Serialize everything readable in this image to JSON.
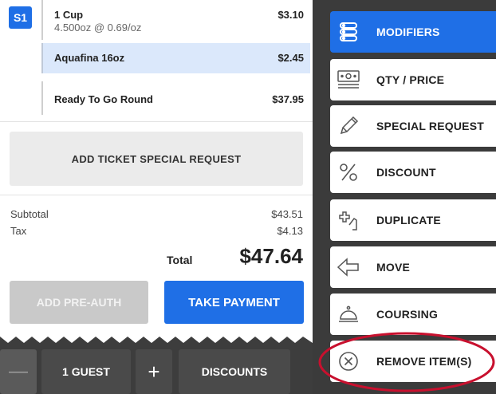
{
  "ticket": {
    "seat": "S1",
    "items": [
      {
        "name": "1 Cup",
        "detail": "4.500oz @ 0.69/oz",
        "price": "$3.10"
      },
      {
        "name": "Aquafina 16oz",
        "price": "$2.45",
        "selected": true
      },
      {
        "name": "Ready To Go Round",
        "price": "$37.95"
      }
    ],
    "add_special_request_label": "ADD TICKET SPECIAL REQUEST"
  },
  "totals": {
    "subtotal_label": "Subtotal",
    "subtotal_value": "$43.51",
    "tax_label": "Tax",
    "tax_value": "$4.13",
    "total_label": "Total",
    "total_value": "$47.64"
  },
  "payment": {
    "preauth_label": "ADD PRE-AUTH",
    "take_payment_label": "TAKE PAYMENT"
  },
  "bottom_bar": {
    "minus_label": "—",
    "guest_label": "1 GUEST",
    "plus_label": "+",
    "discounts_label": "DISCOUNTS"
  },
  "actions": [
    {
      "label": "MODIFIERS",
      "icon": "modifiers-icon",
      "active": true
    },
    {
      "label": "QTY / PRICE",
      "icon": "qty-price-icon"
    },
    {
      "label": "SPECIAL REQUEST",
      "icon": "pencil-icon"
    },
    {
      "label": "DISCOUNT",
      "icon": "percent-icon"
    },
    {
      "label": "DUPLICATE",
      "icon": "duplicate-icon"
    },
    {
      "label": "MOVE",
      "icon": "move-arrow-icon"
    },
    {
      "label": "COURSING",
      "icon": "cloche-icon"
    },
    {
      "label": "REMOVE ITEM(S)",
      "icon": "remove-x-icon",
      "highlighted": true
    }
  ],
  "colors": {
    "accent_blue": "#1f6fe6",
    "dark_panel": "#3b3b3b",
    "selected_row": "#dbe8fb",
    "highlight_ellipse": "#c8102e"
  }
}
